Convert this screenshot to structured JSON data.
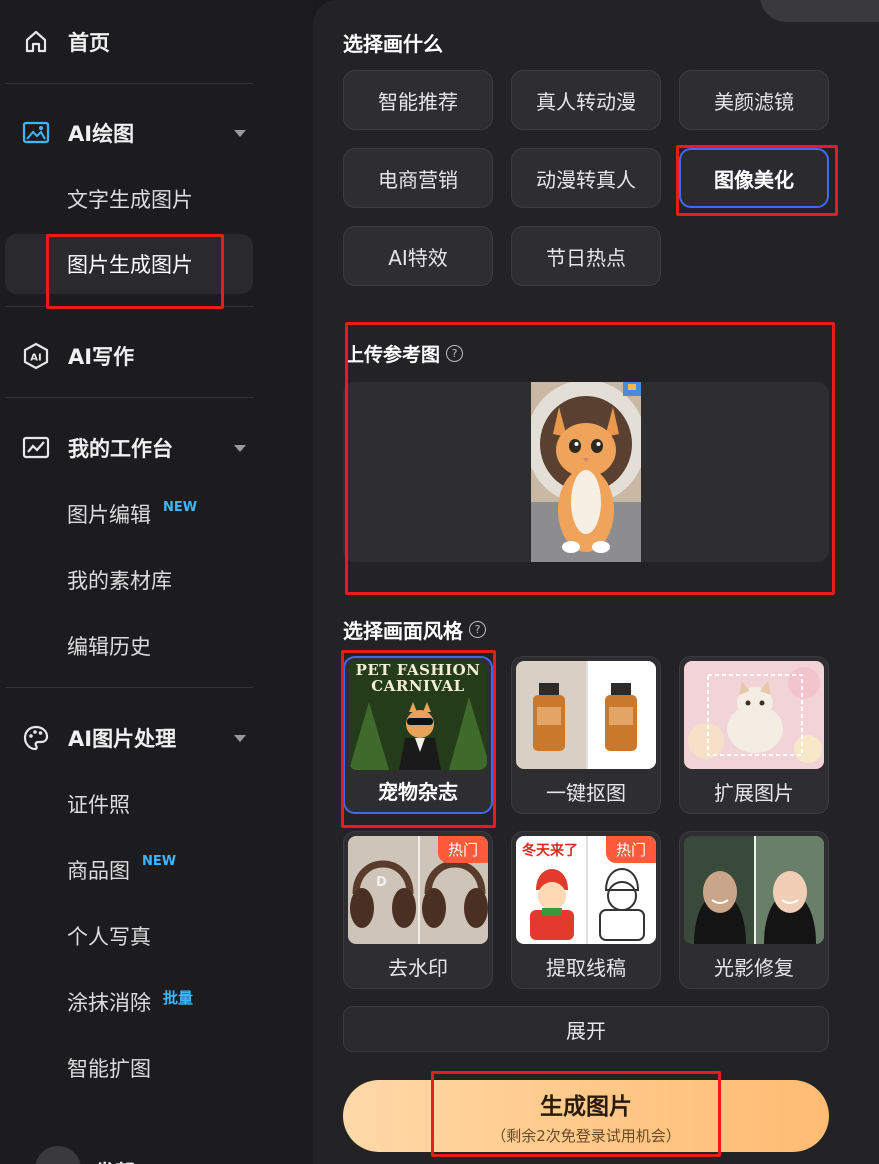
{
  "sidebar": {
    "home": {
      "label": "首页",
      "icon": "home-icon"
    },
    "ai_drawing": {
      "label": "AI绘图",
      "icon": "image-frame-icon",
      "items": [
        {
          "label": "文字生成图片"
        },
        {
          "label": "图片生成图片"
        }
      ]
    },
    "ai_writing": {
      "label": "AI写作",
      "icon": "ai-hexagon-icon"
    },
    "workbench": {
      "label": "我的工作台",
      "icon": "chart-line-icon",
      "items": [
        {
          "label": "图片编辑",
          "badge": "NEW"
        },
        {
          "label": "我的素材库"
        },
        {
          "label": "编辑历史"
        }
      ]
    },
    "ai_image": {
      "label": "AI图片处理",
      "icon": "palette-icon",
      "items": [
        {
          "label": "证件照"
        },
        {
          "label": "商品图",
          "badge": "NEW"
        },
        {
          "label": "个人写真"
        },
        {
          "label": "涂抹消除",
          "badge": "批量"
        },
        {
          "label": "智能扩图"
        }
      ]
    },
    "bottom_label": "发帮"
  },
  "main": {
    "choose_title": "选择画什么",
    "categories": [
      {
        "label": "智能推荐"
      },
      {
        "label": "真人转动漫"
      },
      {
        "label": "美颜滤镜"
      },
      {
        "label": "电商营销"
      },
      {
        "label": "动漫转真人"
      },
      {
        "label": "图像美化",
        "selected": true
      },
      {
        "label": "AI特效"
      },
      {
        "label": "节日热点"
      }
    ],
    "upload_title": "上传参考图",
    "style_title": "选择画面风格",
    "styles": [
      {
        "label": "宠物杂志",
        "selected": true,
        "thumb_text": [
          "PET FASHION",
          "CARNIVAL"
        ]
      },
      {
        "label": "一键抠图"
      },
      {
        "label": "扩展图片"
      },
      {
        "label": "去水印",
        "hot": "热门"
      },
      {
        "label": "提取线稿",
        "hot": "热门",
        "thumb_text": "冬天来了"
      },
      {
        "label": "光影修复"
      }
    ],
    "expand_label": "展开",
    "generate": {
      "label": "生成图片",
      "sub": "（剩余2次免登录试用机会）"
    }
  },
  "colors": {
    "accent_blue": "#3d6cf0",
    "hot_red": "#ff5a3c",
    "new_blue": "#3fb6ff",
    "button_orange": "#ffc98a"
  }
}
